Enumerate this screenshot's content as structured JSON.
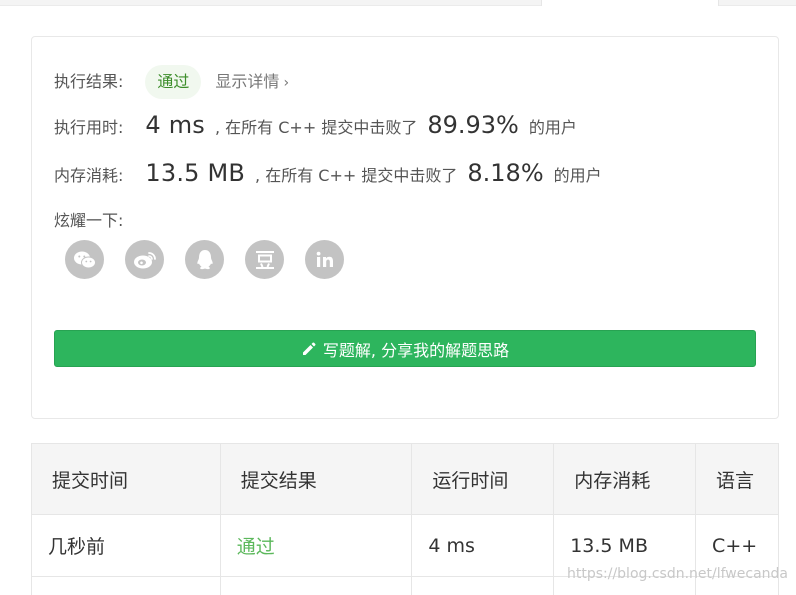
{
  "result": {
    "status_label": "执行结果:",
    "status_value": "通过",
    "details_link": "显示详情",
    "runtime": {
      "label": "执行用时:",
      "value": "4 ms",
      "text": ", 在所有 C++ 提交中击败了",
      "percent": "89.93%",
      "users": "的用户"
    },
    "memory": {
      "label": "内存消耗:",
      "value": "13.5 MB",
      "text": ", 在所有 C++ 提交中击败了",
      "percent": "8.18%",
      "users": "的用户"
    },
    "share_label": "炫耀一下:",
    "share_icons": [
      "wechat-icon",
      "weibo-icon",
      "qq-icon",
      "douban-icon",
      "linkedin-icon"
    ],
    "solution_button": "写题解, 分享我的解题思路"
  },
  "submissions": {
    "columns": [
      "提交时间",
      "提交结果",
      "运行时间",
      "内存消耗",
      "语言"
    ],
    "rows": [
      [
        "几秒前",
        "通过",
        "4 ms",
        "13.5 MB",
        "C++"
      ]
    ]
  },
  "watermark": "https://blog.csdn.net/lfwecanda",
  "colors": {
    "accent_green": "#2db55d",
    "pass_green": "#5cb85c",
    "icon_gray": "#c3c3c3"
  }
}
